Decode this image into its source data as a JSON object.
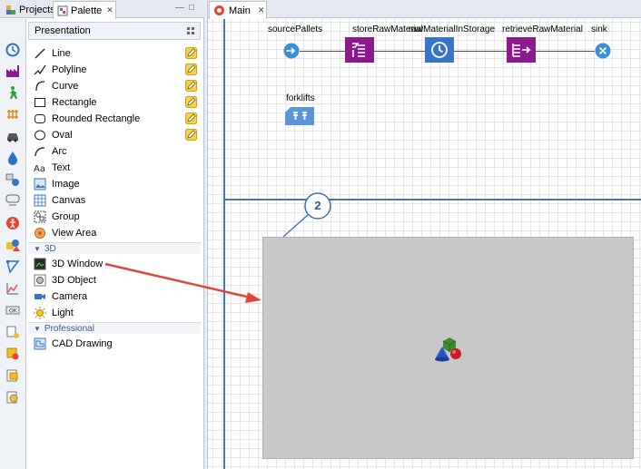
{
  "left_tabs": {
    "projects": "Projects",
    "palette": "Palette",
    "close_glyph": "✕"
  },
  "palette": {
    "presentation_header": "Presentation",
    "presentation_items": [
      {
        "label": "Line",
        "icon": "line-icon",
        "editable": true
      },
      {
        "label": "Polyline",
        "icon": "polyline-icon",
        "editable": true
      },
      {
        "label": "Curve",
        "icon": "curve-icon",
        "editable": true
      },
      {
        "label": "Rectangle",
        "icon": "rectangle-icon",
        "editable": true
      },
      {
        "label": "Rounded Rectangle",
        "icon": "rounded-rectangle-icon",
        "editable": true
      },
      {
        "label": "Oval",
        "icon": "oval-icon",
        "editable": true
      },
      {
        "label": "Arc",
        "icon": "arc-icon",
        "editable": false
      },
      {
        "label": "Text",
        "icon": "text-icon",
        "editable": false
      },
      {
        "label": "Image",
        "icon": "image-icon",
        "editable": false
      },
      {
        "label": "Canvas",
        "icon": "canvas-icon",
        "editable": false
      },
      {
        "label": "Group",
        "icon": "group-icon",
        "editable": false
      },
      {
        "label": "View Area",
        "icon": "view-area-icon",
        "editable": false
      }
    ],
    "section_3d": "3D",
    "items_3d": [
      {
        "label": "3D Window",
        "icon": "3d-window-icon"
      },
      {
        "label": "3D Object",
        "icon": "3d-object-icon"
      },
      {
        "label": "Camera",
        "icon": "camera-icon"
      },
      {
        "label": "Light",
        "icon": "light-icon"
      }
    ],
    "section_professional": "Professional",
    "items_professional": [
      {
        "label": "CAD Drawing",
        "icon": "cad-drawing-icon"
      }
    ]
  },
  "editor": {
    "tab_label": "Main",
    "close_glyph": "✕",
    "blocks": [
      {
        "label": "sourcePallets",
        "icon": "source-icon"
      },
      {
        "label": "storeRawMaterial",
        "icon": "store-icon"
      },
      {
        "label": "rawMaterialInStorage",
        "icon": "clock-icon"
      },
      {
        "label": "retrieveRawMaterial",
        "icon": "retrieve-icon"
      },
      {
        "label": "sink",
        "icon": "sink-icon"
      }
    ],
    "resource_label": "forklifts",
    "callout_number": "2"
  },
  "colors": {
    "accent_blue": "#4a73b8",
    "process_purple": "#8b1a8b",
    "storage_blue": "#3a74c9",
    "circle_blue": "#3b8fd6",
    "arrow_red": "#e0453a",
    "window_gray": "#c8c8c8"
  }
}
